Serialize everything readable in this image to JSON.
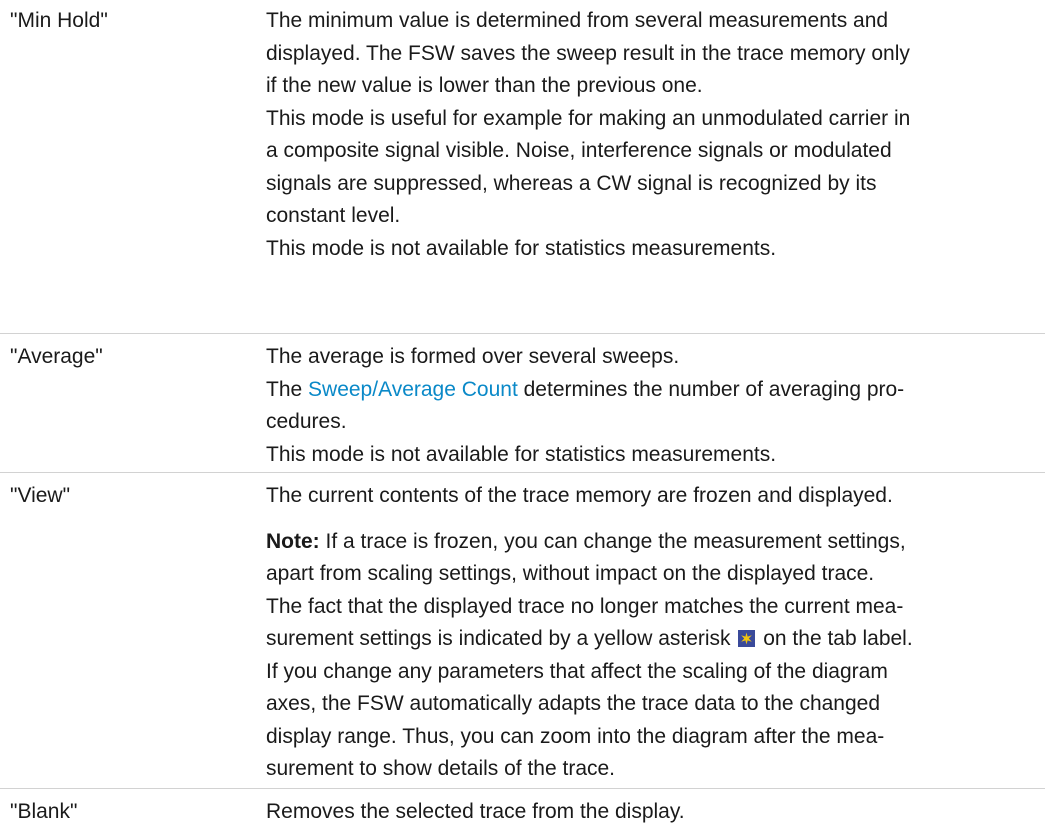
{
  "entries": [
    {
      "term": "\"Min Hold\"",
      "lines": [
        "The minimum value is determined from several measurements and",
        "displayed. The FSW saves the sweep result in the trace memory only",
        "if the new value is lower than the previous one.",
        "This mode is useful for example for making an unmodulated carrier in",
        "a composite signal visible. Noise, interference signals or modulated",
        "signals are suppressed, whereas a CW signal is recognized by its",
        "constant level.",
        "This mode is not available for statistics measurements."
      ]
    },
    {
      "term": "\"Average\"",
      "line1": "The average is formed over several sweeps.",
      "line2_prefix": "The ",
      "link": "Sweep/Average Count",
      "line2_suffix": " determines the number of averaging pro-",
      "line3": "cedures.",
      "line4": "This mode is not available for statistics measurements."
    },
    {
      "term": "\"View\"",
      "line1": "The current contents of the trace memory are frozen and displayed.",
      "note_label": "Note:",
      "note_line1_rest": " If a trace is frozen, you can change the measurement settings,",
      "note_line2": "apart from scaling settings, without impact on the displayed trace.",
      "note_line3": "The fact that the displayed trace no longer matches the current mea-",
      "note_line4_prefix": "surement settings is indicated by a yellow asterisk",
      "note_line4_suffix": "on the tab label.",
      "note_line5": "If you change any parameters that affect the scaling of the diagram",
      "note_line6": "axes, the FSW automatically adapts the trace data to the changed",
      "note_line7": "display range. Thus, you can zoom into the diagram after the mea-",
      "note_line8": "surement to show details of the trace.",
      "asterisk_icon": "yellow-asterisk-icon"
    },
    {
      "term": "\"Blank\"",
      "line1": "Removes the selected trace from the display."
    }
  ],
  "colors": {
    "text": "#1a1a1a",
    "link": "#0a89c8",
    "divider": "#d2d2d2",
    "asterisk_bg": "#3a4a9a",
    "asterisk_star": "#f2c40f"
  }
}
